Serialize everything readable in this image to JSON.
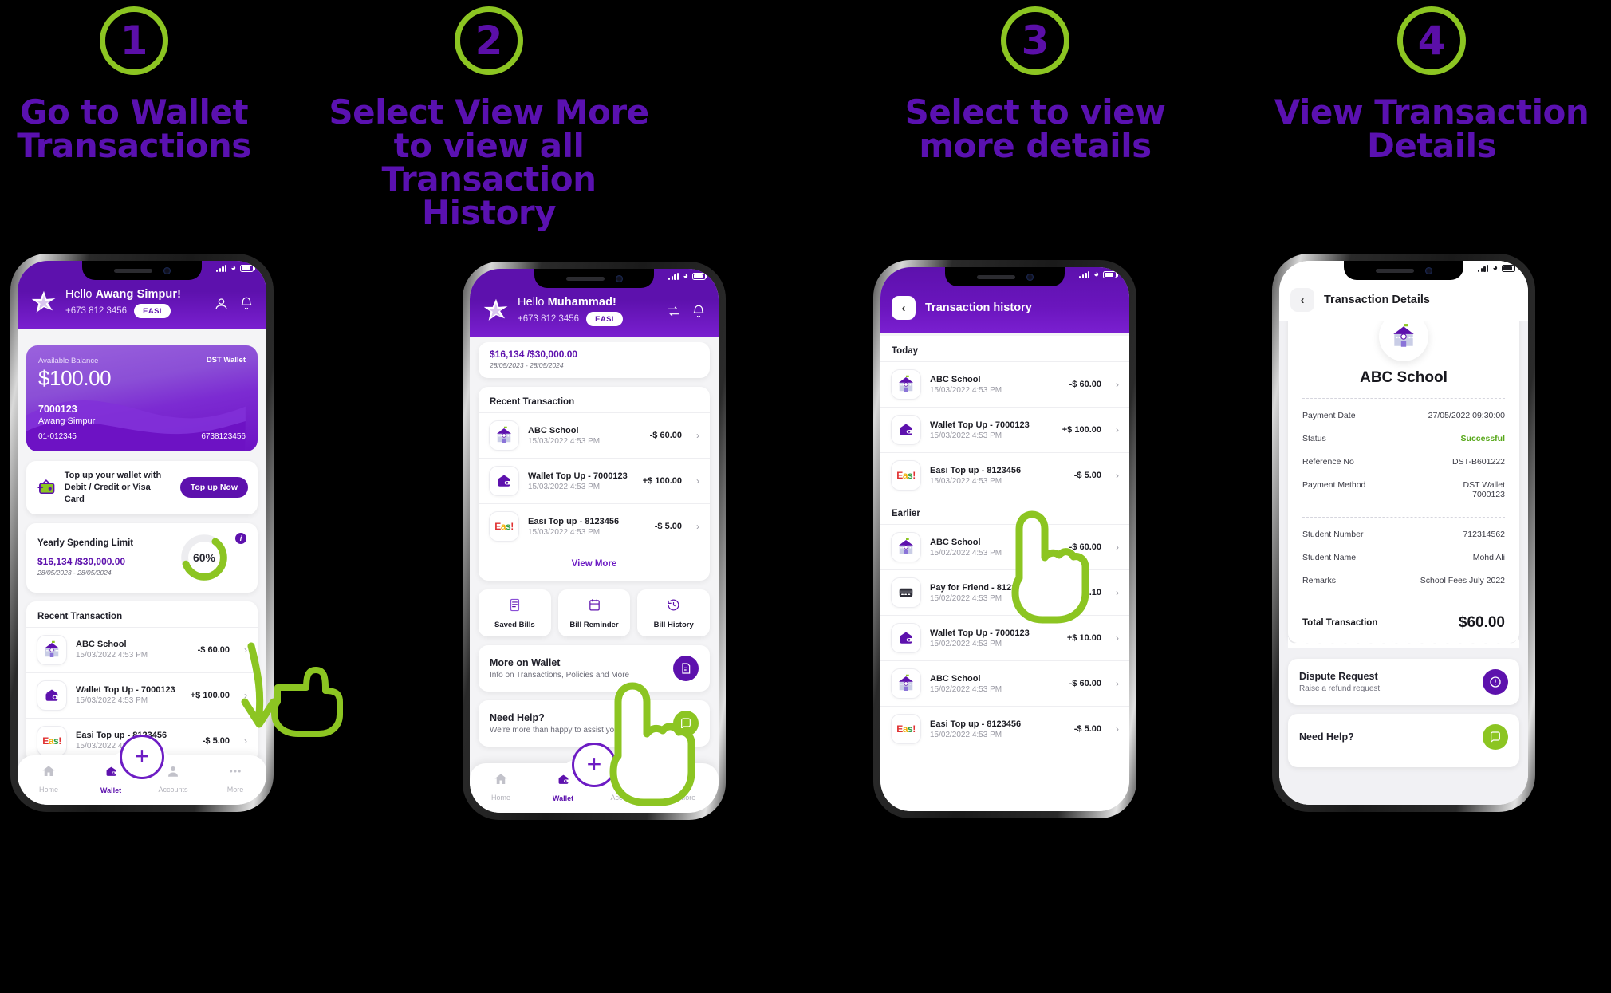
{
  "theme": {
    "purple": "#5d11ad",
    "purple_light": "#7a1fd0",
    "green": "#8cc522",
    "success": "#58a81b"
  },
  "steps": [
    {
      "number": "1",
      "title": "Go to Wallet Transactions"
    },
    {
      "number": "2",
      "title": "Select View More to view all Transaction History"
    },
    {
      "number": "3",
      "title": "Select to view more details"
    },
    {
      "number": "4",
      "title": "View Transaction Details"
    }
  ],
  "phone1": {
    "header": {
      "greeting_prefix": "Hello ",
      "user_name": "Awang Simpur!",
      "phone": "+673 812 3456",
      "chip": "EASI"
    },
    "balance_card": {
      "label": "Available Balance",
      "amount": "$100.00",
      "wallet_tag": "DST\nWallet",
      "account_no": "7000123",
      "account_name": "Awang Simpur",
      "ref_left": "01-012345",
      "ref_right": "6738123456"
    },
    "topup": {
      "line1": "Top up your wallet with",
      "line2": "Debit / Credit or Visa Card",
      "button": "Top up Now"
    },
    "spending": {
      "title": "Yearly Spending Limit",
      "amount": "$16,134 /$30,000.00",
      "range": "28/05/2023 - 28/05/2024",
      "percent": "60%",
      "percent_value": 60
    },
    "recent_title": "Recent Transaction",
    "transactions": [
      {
        "icon": "school-icon",
        "name": "ABC School",
        "date": "15/03/2022 4:53 PM",
        "amount": "-$ 60.00"
      },
      {
        "icon": "wallet-icon",
        "name": "Wallet Top Up - 7000123",
        "date": "15/03/2022 4:53 PM",
        "amount": "+$ 100.00"
      },
      {
        "icon": "easi-icon",
        "name": "Easi Top up  - 8123456",
        "date": "15/03/2022 4:53 PM",
        "amount": "-$ 5.00"
      }
    ],
    "tabs": [
      {
        "label": "Home",
        "icon": "home-icon",
        "active": false
      },
      {
        "label": "Wallet",
        "icon": "wallet-icon",
        "active": true
      },
      {
        "label": "Accounts",
        "icon": "person-icon",
        "active": false
      },
      {
        "label": "More",
        "icon": "dots-icon",
        "active": false
      }
    ],
    "fab": "+"
  },
  "phone2": {
    "header": {
      "greeting_prefix": "Hello ",
      "user_name": "Muhammad!",
      "phone": "+673 812 3456",
      "chip": "EASI"
    },
    "spending": {
      "amount": "$16,134 /$30,000.00",
      "range": "28/05/2023 - 28/05/2024"
    },
    "recent_title": "Recent Transaction",
    "transactions": [
      {
        "icon": "school-icon",
        "name": "ABC School",
        "date": "15/03/2022 4:53 PM",
        "amount": "-$ 60.00"
      },
      {
        "icon": "wallet-icon",
        "name": "Wallet Top Up - 7000123",
        "date": "15/03/2022 4:53 PM",
        "amount": "+$ 100.00"
      },
      {
        "icon": "easi-icon",
        "name": "Easi Top up  - 8123456",
        "date": "15/03/2022 4:53 PM",
        "amount": "-$ 5.00"
      }
    ],
    "view_more": "View More",
    "tiles": [
      {
        "label": "Saved Bills",
        "icon": "bill-icon"
      },
      {
        "label": "Bill Reminder",
        "icon": "reminder-icon"
      },
      {
        "label": "Bill History",
        "icon": "history-icon"
      }
    ],
    "more_on_wallet": {
      "title": "More on Wallet",
      "subtitle": "Info on Transactions, Policies and More",
      "icon": "doc-icon"
    },
    "need_help": {
      "title": "Need Help?",
      "subtitle": "We're more than happy to assist you",
      "icon": "chat-icon"
    },
    "tabs": [
      {
        "label": "Home",
        "icon": "home-icon",
        "active": false
      },
      {
        "label": "Wallet",
        "icon": "wallet-icon",
        "active": true
      },
      {
        "label": "Accounts",
        "icon": "person-icon",
        "active": false
      },
      {
        "label": "More",
        "icon": "dots-icon",
        "active": false
      }
    ],
    "fab": "+"
  },
  "phone3": {
    "title": "Transaction history",
    "groups": [
      {
        "label": "Today",
        "items": [
          {
            "icon": "school-icon",
            "name": "ABC School",
            "date": "15/03/2022 4:53 PM",
            "amount": "-$ 60.00"
          },
          {
            "icon": "wallet-icon",
            "name": "Wallet Top Up - 7000123",
            "date": "15/03/2022 4:53 PM",
            "amount": "+$ 100.00"
          },
          {
            "icon": "easi-icon",
            "name": "Easi Top up  - 8123456",
            "date": "15/03/2022 4:53 PM",
            "amount": "-$ 5.00"
          }
        ]
      },
      {
        "label": "Earlier",
        "items": [
          {
            "icon": "school-icon",
            "name": "ABC School",
            "date": "15/02/2022 4:53 PM",
            "amount": "-$ 60.00"
          },
          {
            "icon": "card-icon",
            "name": "Pay for Friend - 8123457",
            "date": "15/02/2022 4:53 PM",
            "amount": "-$ 32.10"
          },
          {
            "icon": "wallet-icon",
            "name": "Wallet Top Up - 7000123",
            "date": "15/02/2022 4:53 PM",
            "amount": "+$ 10.00"
          },
          {
            "icon": "school-icon",
            "name": "ABC School",
            "date": "15/02/2022 4:53 PM",
            "amount": "-$ 60.00"
          },
          {
            "icon": "easi-icon",
            "name": "Easi Top up  - 8123456",
            "date": "15/02/2022 4:53 PM",
            "amount": "-$ 5.00"
          }
        ]
      }
    ]
  },
  "phone4": {
    "title": "Transaction Details",
    "merchant": "ABC School",
    "rows": [
      {
        "key": "Payment Date",
        "value": "27/05/2022 09:30:00",
        "status": false
      },
      {
        "key": "Status",
        "value": "Successful",
        "status": true
      },
      {
        "key": "Reference No",
        "value": "DST-B601222",
        "status": false
      },
      {
        "key": "Payment Method",
        "value": "DST Wallet\n7000123",
        "status": false
      }
    ],
    "rows2": [
      {
        "key": "Student  Number",
        "value": "712314562"
      },
      {
        "key": "Student Name",
        "value": "Mohd Ali"
      },
      {
        "key": "Remarks",
        "value": "School Fees July 2022"
      }
    ],
    "total": {
      "key": "Total Transaction",
      "value": "$60.00"
    },
    "dispute": {
      "title": "Dispute Request",
      "subtitle": "Raise a refund request",
      "icon": "alert-icon"
    },
    "need_help": {
      "title": "Need Help?"
    }
  }
}
